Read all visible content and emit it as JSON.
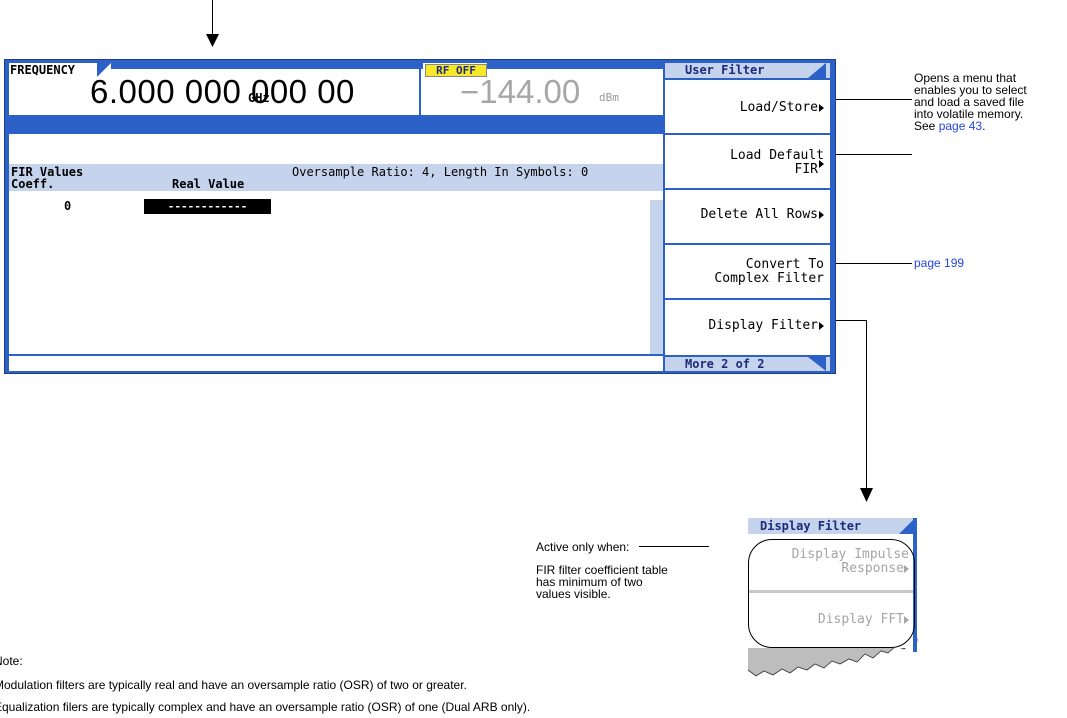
{
  "frequency": {
    "label": "FREQUENCY",
    "value": "6.000 000 000 00",
    "unit": "GHz"
  },
  "amplitude": {
    "rf_badge": "RF OFF",
    "value": "−144.00",
    "unit": "dBm"
  },
  "table": {
    "title": "FIR Values",
    "col_coeff": "Coeff.",
    "col_real": "Real Value",
    "info": "Oversample Ratio: 4, Length In Symbols: 0",
    "rows": [
      {
        "index": "0",
        "value": "------------"
      }
    ]
  },
  "softkeys": {
    "menu_title": "User Filter",
    "load_store": "Load/Store",
    "load_default_1": "Load Default",
    "load_default_2": "FIR",
    "delete_all_rows": "Delete All Rows",
    "convert_1": "Convert To",
    "convert_2": "Complex Filter",
    "display_filter": "Display Filter",
    "more": "More 2 of 2"
  },
  "annotations": {
    "load_store_note_1": "Opens a menu that",
    "load_store_note_2": "enables you to select",
    "load_store_note_3": "and load a saved file",
    "load_store_note_4": "into volatile memory.",
    "load_store_note_see": "See",
    "load_store_note_link": "page 43",
    "load_store_note_end": ".",
    "convert_link": "page 199",
    "active_only": "Active only when:",
    "active_1": "FIR filter coefficient table",
    "active_2": "has minimum of two",
    "active_3": "values visible.",
    "note_label": "Note:",
    "note_1": "Modulation filters are typically real and have an oversample ratio (OSR) of two or greater.",
    "note_2": "Equalization filers are typically complex and have an oversample ratio (OSR) of one (Dual ARB only)."
  },
  "display_filter_menu": {
    "title": "Display Filter",
    "impulse_1": "Display Impulse",
    "impulse_2": "Response",
    "fft": "Display FFT"
  },
  "colors": {
    "frame_blue": "#2c62c8",
    "label_blue": "#c6d3ec",
    "rf_badge_yellow": "#f7e82a",
    "link_blue": "#2245e6"
  }
}
